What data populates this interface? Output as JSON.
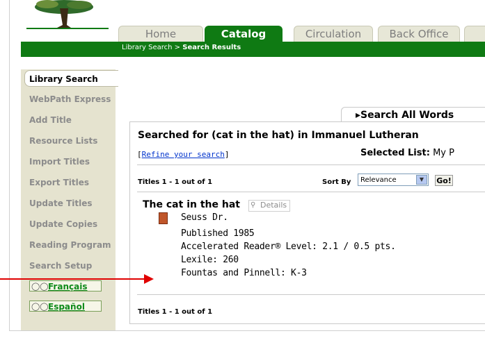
{
  "tabs": [
    "Home",
    "Catalog",
    "Circulation",
    "Back Office"
  ],
  "breadcrumb": {
    "path": "Library Search > ",
    "current": "Search Results"
  },
  "sidebar": {
    "active": "Library Search",
    "items": [
      "WebPath Express",
      "Add Title",
      "Resource Lists",
      "Import Titles",
      "Export Titles",
      "Update Titles",
      "Update Copies",
      "Reading Program",
      "Search Setup"
    ],
    "languages": [
      "Français",
      "Español"
    ]
  },
  "search_tab": "Search All Words",
  "searched_for": "Searched for (cat in the hat) in Immanuel Lutheran",
  "refine": {
    "open": "[",
    "link": "Refine your search",
    "close": "]"
  },
  "selected_list": {
    "label": "Selected List:",
    "value": "My P"
  },
  "results_count_top": "Titles 1 - 1 out of 1",
  "results_count_bottom": "Titles 1 - 1 out of 1",
  "sort_by": {
    "label": "Sort By",
    "selected": "Relevance"
  },
  "go_label": "Go!",
  "result": {
    "title": "The cat in the hat",
    "details_label": "Details",
    "author": "Seuss Dr.",
    "published": "Published 1985",
    "ar_level": "Accelerated Reader® Level:  2.1 / 0.5 pts.",
    "lexile": "Lexile: 260",
    "fountas": "Fountas and Pinnell: K-3"
  },
  "colors": {
    "brand_green": "#0f7a13",
    "sidebar_bg": "#e5e3cf",
    "annotation_arrow": "#e00000"
  }
}
